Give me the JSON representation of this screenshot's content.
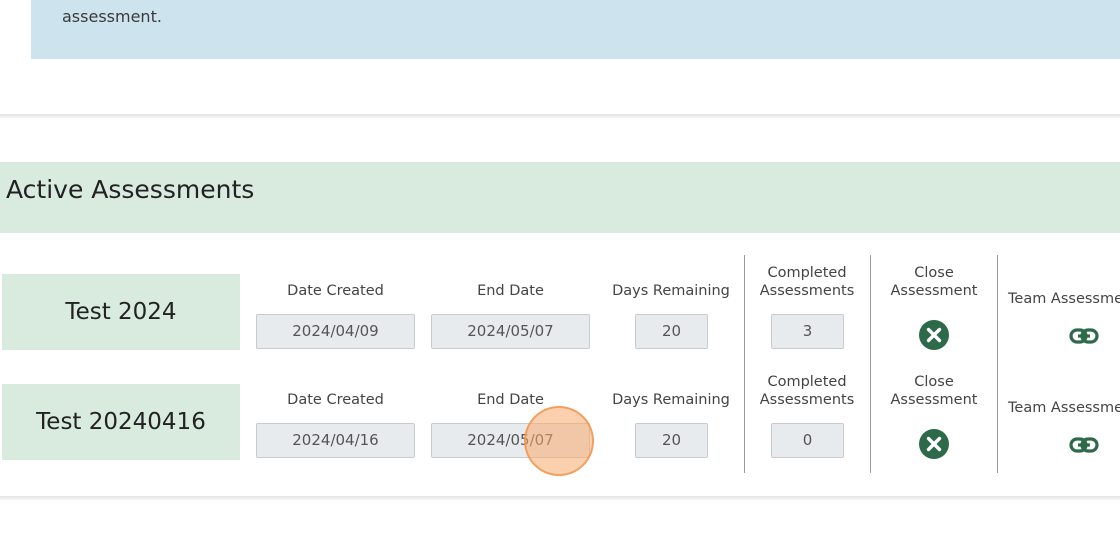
{
  "banner": {
    "text": "assessment."
  },
  "section": {
    "title": "Active Assessments"
  },
  "columns": {
    "date_created": "Date Created",
    "end_date": "End Date",
    "days_remaining": "Days Remaining",
    "completed_line1": "Completed",
    "completed_line2": "Assessments",
    "close_line1": "Close",
    "close_line2": "Assessment",
    "team": "Team Assessment"
  },
  "assessments": [
    {
      "name": "Test 2024",
      "date_created": "2024/04/09",
      "end_date": "2024/05/07",
      "days_remaining": "20",
      "completed": "3"
    },
    {
      "name": "Test 20240416",
      "date_created": "2024/04/16",
      "end_date": "2024/05/07",
      "days_remaining": "20",
      "completed": "0"
    }
  ],
  "icons": {
    "close": "close-circle-icon",
    "link": "link-icon"
  },
  "colors": {
    "banner_bg": "#cde3ee",
    "header_bg": "#d9ebdf",
    "icon_green": "#2d6a4a",
    "cursor": "#f5a35f"
  }
}
